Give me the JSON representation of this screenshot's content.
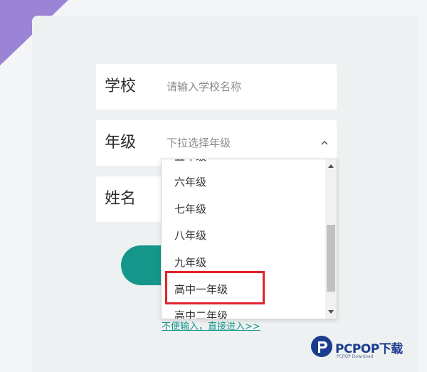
{
  "form": {
    "school": {
      "label": "学校",
      "placeholder": "请输入学校名称"
    },
    "grade": {
      "label": "年级",
      "placeholder": "下拉选择年级"
    },
    "name": {
      "label": "姓名"
    },
    "skip_link": "不便输入，直接进入>>"
  },
  "dropdown": {
    "options": [
      {
        "label": "五年级"
      },
      {
        "label": "六年级"
      },
      {
        "label": "七年级"
      },
      {
        "label": "八年级"
      },
      {
        "label": "九年级"
      },
      {
        "label": "高中一年级",
        "highlighted": true
      },
      {
        "label": "高中二年级"
      }
    ]
  },
  "watermark": {
    "brand": "PCPOP下载",
    "sub": "PCPOP Download"
  },
  "colors": {
    "accent": "#16968a",
    "highlight": "#e0242c",
    "corner": "#9b84d6"
  }
}
